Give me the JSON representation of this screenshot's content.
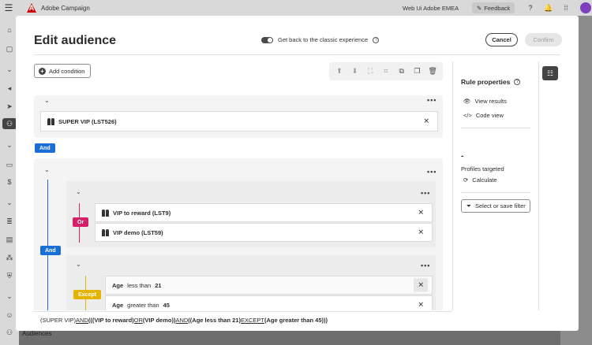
{
  "app": {
    "name": "Adobe Campaign",
    "org": "Web Ui Adobe EMEA",
    "feedback": "Feedback",
    "bottom_nav": "Audiences"
  },
  "modal": {
    "title": "Edit audience",
    "classic_toggle_label": "Get back to the classic experience",
    "cancel": "Cancel",
    "confirm": "Confirm"
  },
  "editor": {
    "add_condition": "Add condition",
    "and_label": "And",
    "or_label": "Or",
    "except_label": "Except",
    "conditions": {
      "super_vip": "SUPER VIP (LST526)",
      "vip_reward": "VIP to reward (LST9)",
      "vip_demo": "VIP demo (LST59)",
      "age_attr_1": "Age",
      "age_op_1": "less than",
      "age_val_1": "21",
      "age_attr_2": "Age",
      "age_op_2": "greater than",
      "age_val_2": "45"
    },
    "expression": [
      {
        "t": "(SUPER VIP) ",
        "b": false
      },
      {
        "t": "AND",
        "b": false,
        "u": true
      },
      {
        "t": " (((VIP to reward) ",
        "b": true
      },
      {
        "t": "OR",
        "b": false,
        "u": true
      },
      {
        "t": " (VIP demo)) ",
        "b": true
      },
      {
        "t": "AND",
        "b": false,
        "u": true
      },
      {
        "t": " ((Age less than 21) ",
        "b": true
      },
      {
        "t": "EXCEPT",
        "b": false,
        "u": true
      },
      {
        "t": " (Age greater than 45)))",
        "b": true
      }
    ]
  },
  "props": {
    "title": "Rule properties",
    "view_results": "View results",
    "code_view": "Code view",
    "count": "-",
    "profiles_targeted": "Profiles targeted",
    "calculate": "Calculate",
    "filter": "Select or save filter"
  },
  "colors": {
    "and": "#1a6ed8",
    "or": "#d61f69",
    "except": "#e4b400"
  }
}
